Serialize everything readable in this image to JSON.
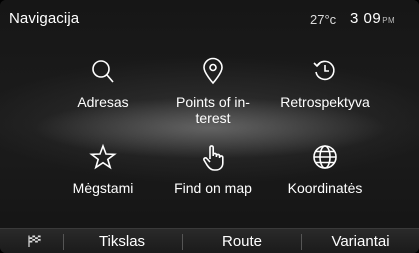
{
  "header": {
    "title": "Navigacija",
    "temperature": "27°c",
    "time": "3 09",
    "ampm": "PM"
  },
  "menu": {
    "items": [
      {
        "label": "Adresas",
        "icon": "search-icon"
      },
      {
        "label": "Points of in-\nterest",
        "icon": "location-pin-icon"
      },
      {
        "label": "Retrospektyva",
        "icon": "history-icon"
      },
      {
        "label": "Mėgstami",
        "icon": "star-icon"
      },
      {
        "label": "Find on map",
        "icon": "hand-pointer-icon"
      },
      {
        "label": "Koordinatės",
        "icon": "globe-icon"
      }
    ]
  },
  "bottom_bar": {
    "flag_icon": "checkered-flag-icon",
    "tabs": [
      "Tikslas",
      "Route",
      "Variantai"
    ]
  }
}
